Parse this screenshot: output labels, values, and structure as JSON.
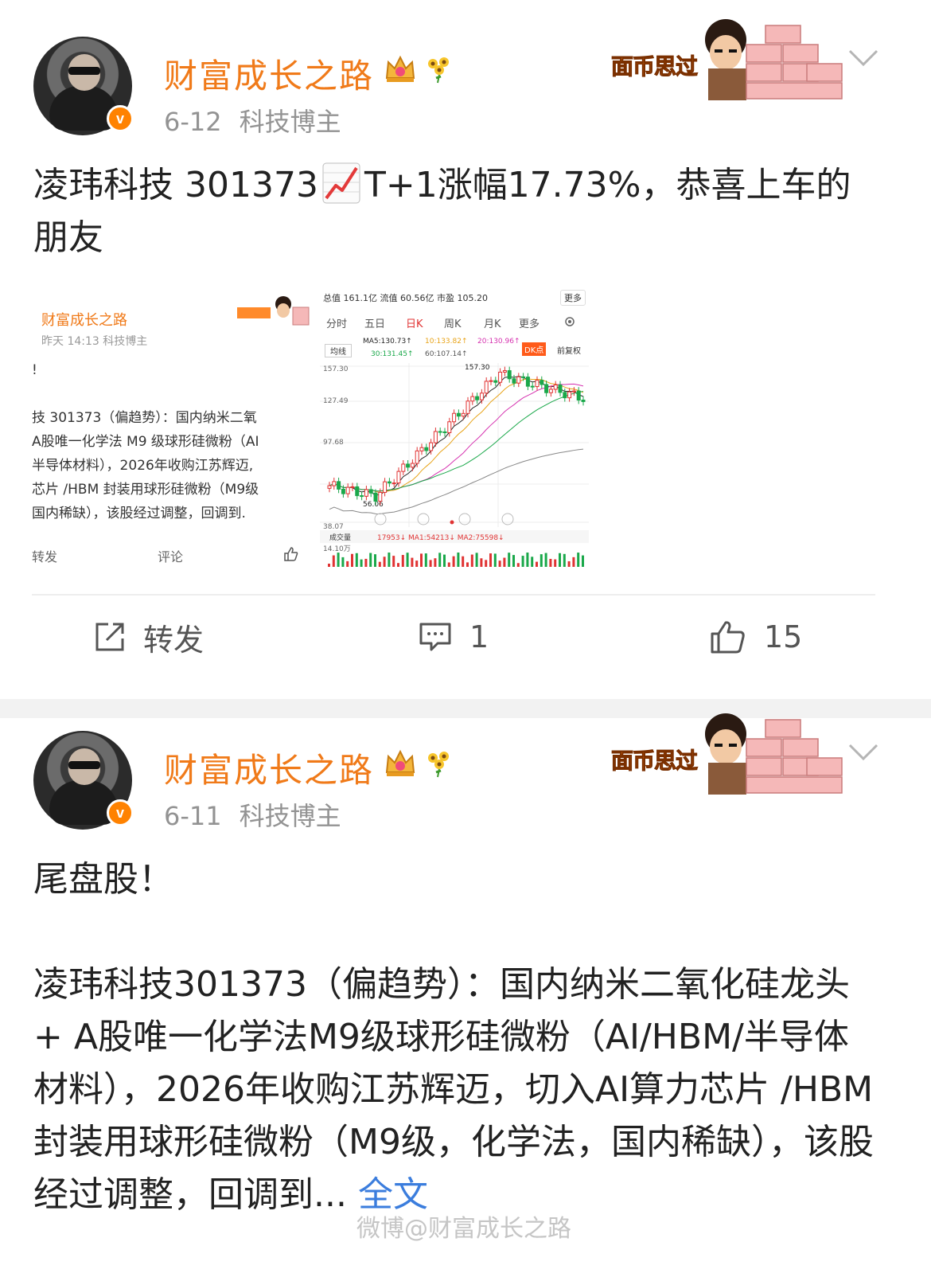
{
  "post1": {
    "username": "财富成长之路",
    "date": "6-12",
    "tag": "科技博主",
    "sticker_text": "面币思过",
    "body_parts": [
      "凌玮科技 301373",
      "T+1涨幅17.73%，恭喜上车的朋友"
    ],
    "chart_emoji_icon": "chart-increasing-icon",
    "actions": {
      "repost_label": "转发",
      "comment_count": "1",
      "like_count": "15"
    }
  },
  "repost_thumb": {
    "username": "财富成长之路",
    "meta": "昨天 14:13  科技博主",
    "body": "!\n\n技 301373（偏趋势）：国内纳米二氧\nA股唯一化学法 M9 级球形硅微粉（AI\n半导体材料），2026年收购江苏辉迈,\n芯片 /HBM 封装用球形硅微粉（M9级\n国内稀缺），该股经过调整，回调到.",
    "repost_label": "转发",
    "comment_label": "评论"
  },
  "stock_chart": {
    "header": "总值 161.1亿   流值 60.56亿   市盈 105.20",
    "more_label": "更多",
    "tabs": [
      "分时",
      "五日",
      "日K",
      "周K",
      "月K",
      "更多"
    ],
    "active_tab": "日K",
    "ma5": "MA5:130.73↑",
    "ma10": "10:133.82↑",
    "ma20": "20:130.96↑",
    "ma30": "30:131.45↑",
    "ma60": "60:107.14↑",
    "mode_label": "均线",
    "dk_label": "DK点",
    "adjust_label": "前复权",
    "y_ticks": [
      "157.30",
      "127.49",
      "97.68",
      "38.07"
    ],
    "peak_label": "157.30",
    "low_label": "56.06",
    "volume_label": "成交量",
    "volume_values": "17953↓  MA1:54213↓  MA2:75598↓",
    "volume_max": "14.10万",
    "colors": {
      "up": "#e03333",
      "down": "#1aa84a",
      "ma5": "#222222",
      "ma10": "#e8a317",
      "ma20": "#d633b0",
      "ma30": "#1aa84a",
      "ma60": "#888888"
    }
  },
  "chart_data": {
    "type": "candlestick",
    "title": "",
    "xlabel": "",
    "ylabel": "",
    "ylim": [
      38.07,
      157.3
    ],
    "y_ticks": [
      157.3,
      127.49,
      97.68,
      38.07
    ],
    "peak": 157.3,
    "low": 56.06
  },
  "post2": {
    "username": "财富成长之路",
    "date": "6-11",
    "tag": "科技博主",
    "sticker_text": "面币思过",
    "line1": "尾盘股！",
    "body": "凌玮科技301373（偏趋势）：国内纳米二氧化硅龙头 + A股唯一化学法M9级球形硅微粉（AI/HBM/半导体材料），2026年收购江苏辉迈，切入AI算力芯片 /HBM封装用球形硅微粉（M9级，化学法，国内稀缺），该股经过调整，回调到...",
    "fulltext_label": "全文"
  },
  "watermark": "微博@财富成长之路"
}
